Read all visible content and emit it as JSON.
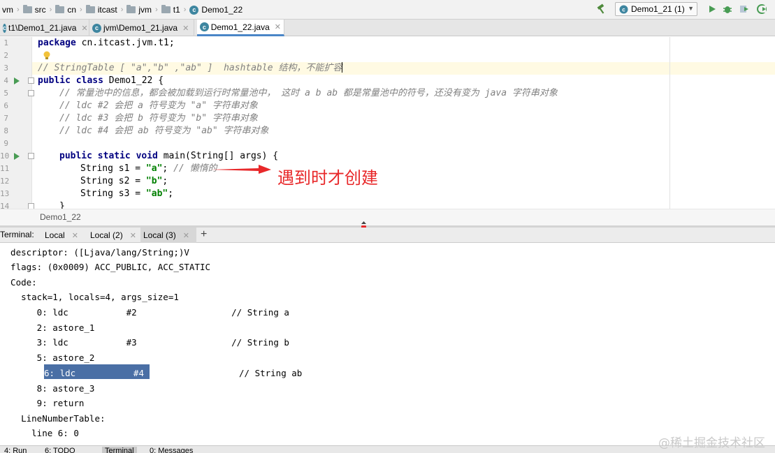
{
  "breadcrumb": {
    "items": [
      {
        "label": "vm",
        "icon": "none"
      },
      {
        "label": "src",
        "icon": "folder-icon"
      },
      {
        "label": "cn",
        "icon": "folder-icon"
      },
      {
        "label": "itcast",
        "icon": "folder-icon"
      },
      {
        "label": "jvm",
        "icon": "folder-icon"
      },
      {
        "label": "t1",
        "icon": "folder-icon"
      },
      {
        "label": "Demo1_22",
        "icon": "class-icon"
      }
    ]
  },
  "toolbar": {
    "run_config": "Demo1_21 (1)",
    "icons": [
      "hammer-icon",
      "run-icon",
      "debug-icon",
      "coverage-icon",
      "profile-icon"
    ]
  },
  "editor_tabs": [
    {
      "label": "t1\\Demo1_21.java",
      "active": false
    },
    {
      "label": "jvm\\Demo1_21.java",
      "active": false
    },
    {
      "label": "Demo1_22.java",
      "active": true
    }
  ],
  "editor": {
    "line_numbers": [
      "1",
      "2",
      "3",
      "4",
      "5",
      "6",
      "7",
      "8",
      "9",
      "10",
      "11",
      "12",
      "13",
      "14"
    ],
    "lines": {
      "l1": {
        "kw": "package",
        "rest": " cn.itcast.jvm.t1;"
      },
      "l3": {
        "comment": "// StringTable [ \"a\",\"b\" ,\"ab\" ]  hashtable 结构，不能扩容"
      },
      "l4": {
        "kw": "public class",
        "rest": " Demo1_22 {"
      },
      "l5": {
        "comment": "// 常量池中的信息，都会被加载到运行时常量池中， 这时 a b ab 都是常量池中的符号，还没有变为 java 字符串对象"
      },
      "l6": {
        "comment": "// ldc #2 会把 a 符号变为 \"a\" 字符串对象"
      },
      "l7": {
        "comment": "// ldc #3 会把 b 符号变为 \"b\" 字符串对象"
      },
      "l8": {
        "comment": "// ldc #4 会把 ab 符号变为 \"ab\" 字符串对象"
      },
      "l10": {
        "kw": "public static void",
        "rest": " main(String[] args) {"
      },
      "l11": {
        "pre": "String s1 = ",
        "str": "\"a\"",
        "post": "; ",
        "comment": "// 懒惰的"
      },
      "l12": {
        "pre": "String s2 = ",
        "str": "\"b\"",
        "post": ";"
      },
      "l13": {
        "pre": "String s3 = ",
        "str": "\"ab\"",
        "post": ";"
      },
      "l14": {
        "rest": "}"
      }
    },
    "annotation": "遇到时才创建",
    "footer": "Demo1_22"
  },
  "terminal": {
    "title": "Terminal:",
    "tabs": [
      {
        "label": "Local",
        "active": false
      },
      {
        "label": "Local (2)",
        "active": false
      },
      {
        "label": "Local (3)",
        "active": true
      }
    ],
    "lines": [
      "  descriptor: ([Ljava/lang/String;)V",
      "  flags: (0x0009) ACC_PUBLIC, ACC_STATIC",
      "  Code:",
      "    stack=1, locals=4, args_size=1",
      "       0: ldc           #2                  // String a",
      "       2: astore_1",
      "       3: ldc           #3                  // String b",
      "       5: astore_2",
      "       6: ldc           #4",
      "       8: astore_3",
      "       9: return",
      "    LineNumberTable:",
      "      line 6: 0"
    ],
    "selected_text": "6: ldc           #4",
    "selected_comment": "// String ab"
  },
  "bottom_tabs": [
    "4: Run",
    "6: TODO",
    "Terminal",
    "0: Messages"
  ],
  "watermark": "@稀土掘金技术社区",
  "colors": {
    "keyword": "#000080",
    "comment": "#808080",
    "string": "#008000",
    "selection": "#4a6fa5",
    "annotation": "#e8282a"
  }
}
